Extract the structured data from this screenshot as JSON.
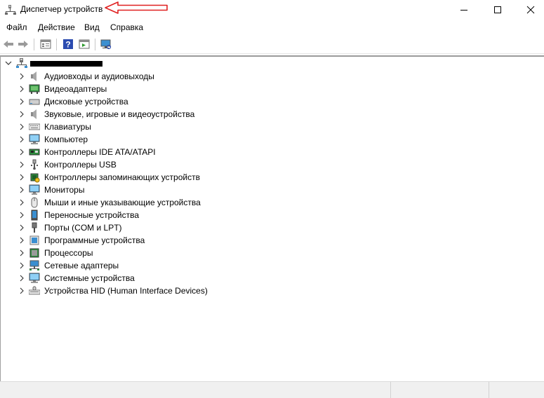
{
  "window": {
    "title": "Диспетчер устройств",
    "controls": {
      "minimize": "minimize-icon",
      "maximize": "maximize-icon",
      "close": "close-icon"
    }
  },
  "menu": [
    "Файл",
    "Действие",
    "Вид",
    "Справка"
  ],
  "toolbar": [
    "back-icon",
    "forward-icon",
    "properties-icon",
    "help-icon",
    "show-hidden-icon",
    "scan-hardware-icon"
  ],
  "tree": {
    "root": {
      "label": "",
      "icon": "computer-network-icon",
      "expanded": true,
      "redacted": true
    },
    "annotation": {
      "type": "arrow",
      "color": "#e02020"
    },
    "items": [
      {
        "label": "Аудиовходы и аудиовыходы",
        "icon": "speaker-icon"
      },
      {
        "label": "Видеоадаптеры",
        "icon": "display-adapter-icon"
      },
      {
        "label": "Дисковые устройства",
        "icon": "disk-drive-icon"
      },
      {
        "label": "Звуковые, игровые и видеоустройства",
        "icon": "sound-icon"
      },
      {
        "label": "Клавиатуры",
        "icon": "keyboard-icon"
      },
      {
        "label": "Компьютер",
        "icon": "computer-icon"
      },
      {
        "label": "Контроллеры IDE ATA/ATAPI",
        "icon": "ide-controller-icon"
      },
      {
        "label": "Контроллеры USB",
        "icon": "usb-icon"
      },
      {
        "label": "Контроллеры запоминающих устройств",
        "icon": "storage-controller-icon"
      },
      {
        "label": "Мониторы",
        "icon": "monitor-icon"
      },
      {
        "label": "Мыши и иные указывающие устройства",
        "icon": "mouse-icon"
      },
      {
        "label": "Переносные устройства",
        "icon": "portable-device-icon"
      },
      {
        "label": "Порты (COM и LPT)",
        "icon": "port-icon"
      },
      {
        "label": "Программные устройства",
        "icon": "software-device-icon"
      },
      {
        "label": "Процессоры",
        "icon": "processor-icon"
      },
      {
        "label": "Сетевые адаптеры",
        "icon": "network-adapter-icon"
      },
      {
        "label": "Системные устройства",
        "icon": "system-device-icon"
      },
      {
        "label": "Устройства HID (Human Interface Devices)",
        "icon": "hid-icon"
      }
    ]
  }
}
